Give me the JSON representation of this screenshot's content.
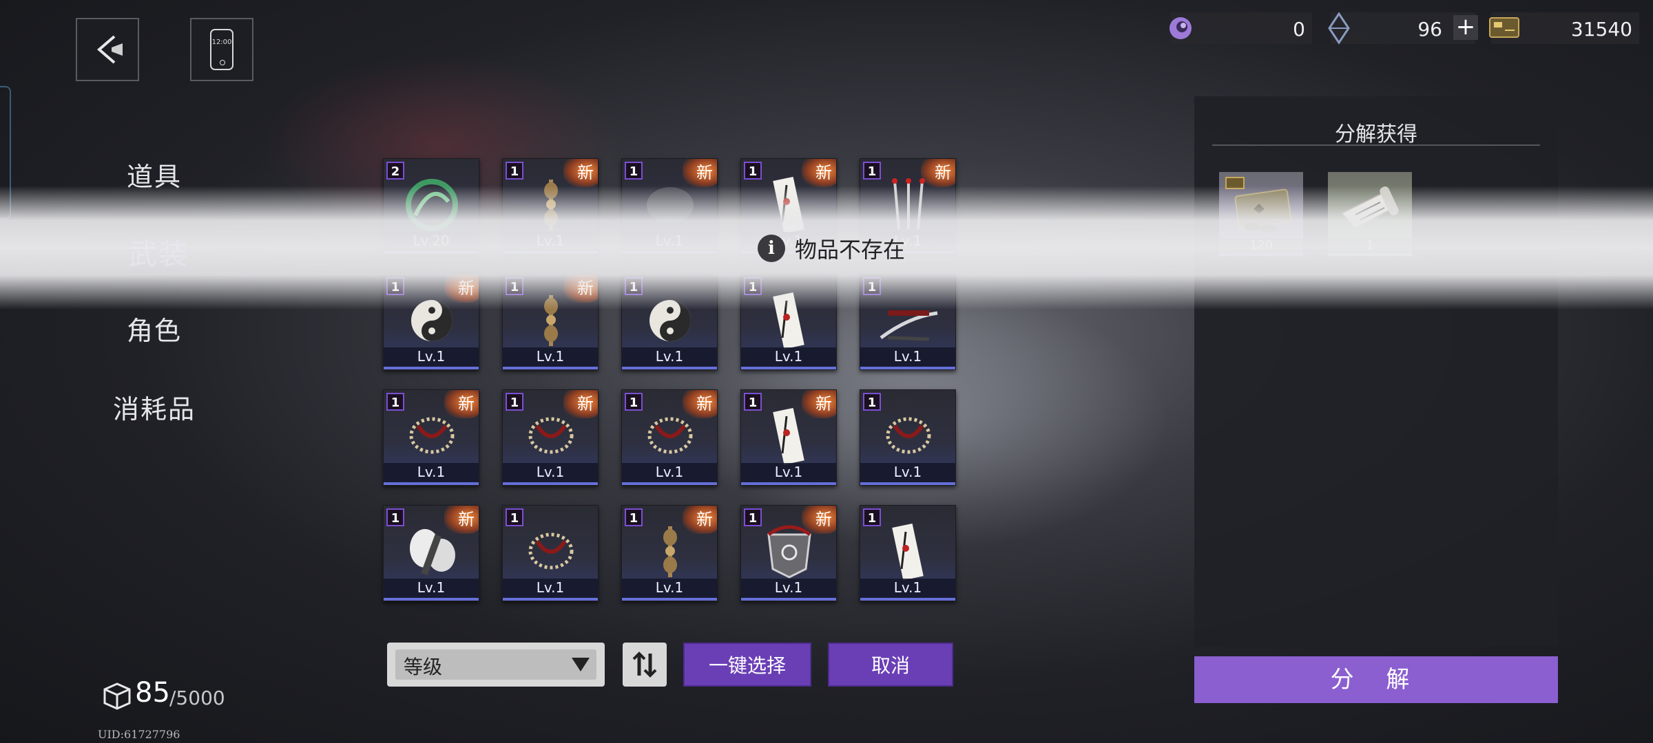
{
  "resources": [
    {
      "name": "purple-currency",
      "value": "0"
    },
    {
      "name": "crystal",
      "value": "96",
      "plus": "+"
    },
    {
      "name": "coin",
      "value": "31540"
    }
  ],
  "nav": {
    "items": [
      {
        "label": "道具",
        "active": false
      },
      {
        "label": "武装",
        "active": true
      },
      {
        "label": "角色",
        "active": false
      },
      {
        "label": "消耗品",
        "active": false
      }
    ]
  },
  "grid": {
    "new_label": "新",
    "items": [
      {
        "count": "2",
        "level": "Lv.20",
        "is_new": false,
        "icon": "jade-dragon-icon"
      },
      {
        "count": "1",
        "level": "Lv.1",
        "is_new": true,
        "icon": "vajra-icon"
      },
      {
        "count": "1",
        "level": "Lv.1",
        "is_new": true,
        "icon": "shadow-icon"
      },
      {
        "count": "1",
        "level": "Lv.1",
        "is_new": true,
        "icon": "talisman-icon"
      },
      {
        "count": "1",
        "level": "Lv.1",
        "is_new": true,
        "icon": "incense-icon"
      },
      {
        "count": "1",
        "level": "Lv.1",
        "is_new": true,
        "icon": "yin-yang-icon"
      },
      {
        "count": "1",
        "level": "Lv.1",
        "is_new": true,
        "icon": "vajra-icon"
      },
      {
        "count": "1",
        "level": "Lv.1",
        "is_new": false,
        "icon": "yin-yang-icon"
      },
      {
        "count": "1",
        "level": "Lv.1",
        "is_new": false,
        "icon": "talisman-icon"
      },
      {
        "count": "1",
        "level": "Lv.1",
        "is_new": false,
        "icon": "katana-icon"
      },
      {
        "count": "1",
        "level": "Lv.1",
        "is_new": true,
        "icon": "prayer-beads-icon"
      },
      {
        "count": "1",
        "level": "Lv.1",
        "is_new": true,
        "icon": "prayer-beads-icon"
      },
      {
        "count": "1",
        "level": "Lv.1",
        "is_new": true,
        "icon": "prayer-beads-icon"
      },
      {
        "count": "1",
        "level": "Lv.1",
        "is_new": true,
        "icon": "talisman-icon"
      },
      {
        "count": "1",
        "level": "Lv.1",
        "is_new": false,
        "icon": "prayer-beads-icon"
      },
      {
        "count": "1",
        "level": "Lv.1",
        "is_new": true,
        "icon": "feather-blade-icon"
      },
      {
        "count": "1",
        "level": "Lv.1",
        "is_new": false,
        "icon": "prayer-beads-icon"
      },
      {
        "count": "1",
        "level": "Lv.1",
        "is_new": true,
        "icon": "vajra-icon"
      },
      {
        "count": "1",
        "level": "Lv.1",
        "is_new": true,
        "icon": "emblem-icon"
      },
      {
        "count": "1",
        "level": "Lv.1",
        "is_new": false,
        "icon": "talisman-icon"
      }
    ]
  },
  "controls": {
    "sort_label": "等级",
    "select_all": "一键选择",
    "cancel": "取消"
  },
  "capacity": {
    "current": "85",
    "max": "/5000"
  },
  "uid": "UID:61727796",
  "panel": {
    "title": "分解获得",
    "rewards": [
      {
        "amount": "120",
        "icon": "coin-stack-icon"
      },
      {
        "amount": "1",
        "icon": "scroll-icon"
      }
    ],
    "decompose": "分 解"
  },
  "toast": {
    "message": "物品不存在"
  },
  "colors": {
    "accent": "#a882e8",
    "button": "#6a3fb6",
    "decompose": "#8b5fd0"
  }
}
